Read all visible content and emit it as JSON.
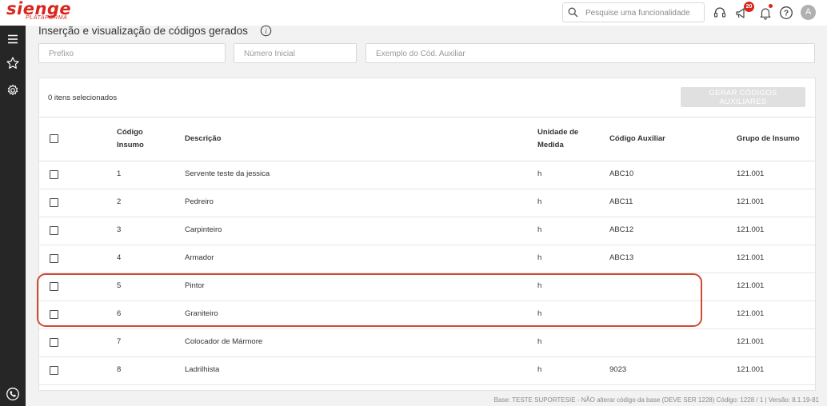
{
  "app": {
    "brand": "sienge",
    "brand_sub": "PLATAFORMA"
  },
  "header": {
    "search_placeholder": "Pesquise uma funcionalidade",
    "notifications_count": "20",
    "avatar_initial": "A"
  },
  "page": {
    "title": "Inserção e visualização de códigos gerados",
    "filters": {
      "prefix_placeholder": "Prefixo",
      "initial_number_placeholder": "Número Inicial",
      "aux_code_placeholder": "Exemplo do Cód. Auxiliar"
    },
    "selected_count": "0 itens selecionados",
    "generate_button": "GERAR CÓDIGOS AUXILIARES"
  },
  "table": {
    "columns": {
      "code": "Código Insumo",
      "description": "Descrição",
      "unit": "Unidade de Medida",
      "aux_code": "Código Auxiliar",
      "group": "Grupo de Insumo"
    },
    "rows": [
      {
        "code": "1",
        "description": "Servente teste da jessica",
        "unit": "h",
        "aux_code": "ABC10",
        "group": "121.001"
      },
      {
        "code": "2",
        "description": "Pedreiro",
        "unit": "h",
        "aux_code": "ABC11",
        "group": "121.001"
      },
      {
        "code": "3",
        "description": "Carpinteiro",
        "unit": "h",
        "aux_code": "ABC12",
        "group": "121.001"
      },
      {
        "code": "4",
        "description": "Armador",
        "unit": "h",
        "aux_code": "ABC13",
        "group": "121.001"
      },
      {
        "code": "5",
        "description": "Pintor",
        "unit": "h",
        "aux_code": "",
        "group": "121.001"
      },
      {
        "code": "6",
        "description": "Graniteiro",
        "unit": "h",
        "aux_code": "",
        "group": "121.001"
      },
      {
        "code": "7",
        "description": "Colocador de Mármore",
        "unit": "h",
        "aux_code": "",
        "group": "121.001"
      },
      {
        "code": "8",
        "description": "Ladrilhista",
        "unit": "h",
        "aux_code": "9023",
        "group": "121.001"
      }
    ]
  },
  "footer": {
    "text": "Base: TESTE SUPORTESIE - NÃO alterar código da base (DEVE SER 1228)  Código: 1228 / 1 | Versão: 8.1.19-81"
  },
  "colors": {
    "brand": "#d9261c",
    "sidebar": "#262626",
    "highlight": "#d04a35"
  },
  "icons": [
    "menu-icon",
    "star-icon",
    "gear-icon",
    "phone-icon",
    "search-icon",
    "headset-icon",
    "megaphone-icon",
    "bell-icon",
    "help-icon",
    "info-icon"
  ]
}
